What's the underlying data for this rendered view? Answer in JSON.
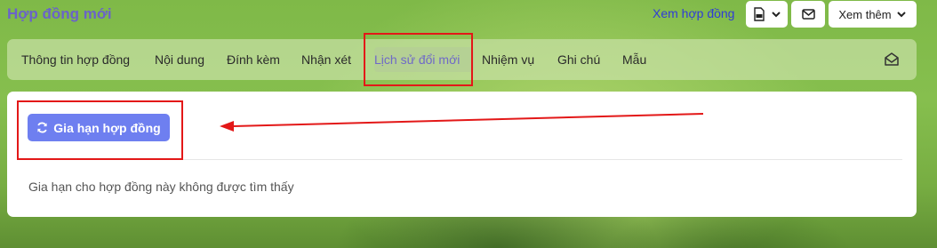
{
  "header": {
    "title": "Hợp đồng mới",
    "view_contract_link": "Xem hợp đồng",
    "more_button_label": "Xem thêm",
    "export_icon": "file-export-icon",
    "mail_icon": "envelope-icon"
  },
  "tabs": [
    {
      "label": "Thông tin hợp đồng"
    },
    {
      "label": "Nội dung"
    },
    {
      "label": "Đính kèm"
    },
    {
      "label": "Nhận xét"
    },
    {
      "label": "Lịch sử đổi mới"
    },
    {
      "label": "Nhiệm vụ"
    },
    {
      "label": "Ghi chú"
    },
    {
      "label": "Mẫu"
    }
  ],
  "active_tab": "Lịch sử đổi mới",
  "content": {
    "renew_button_label": "Gia hạn hợp đồng",
    "renew_button_icon": "refresh-icon",
    "empty_message": "Gia hạn cho hợp đồng này không được tìm thấy"
  },
  "colors": {
    "accent": "#6e7ff0",
    "title": "#6a63c9",
    "annotation": "#e31818"
  }
}
